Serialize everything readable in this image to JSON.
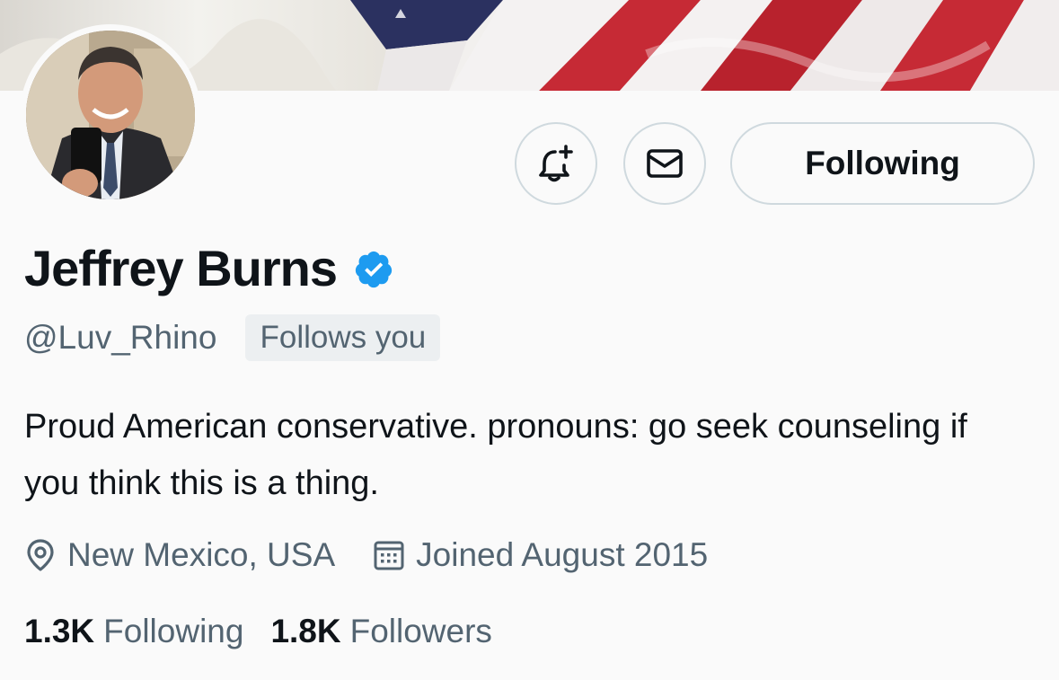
{
  "profile": {
    "display_name": "Jeffrey Burns",
    "handle": "@Luv_Rhino",
    "follows_you": "Follows you",
    "bio": "Proud American conservative. pronouns: go seek counseling if you think this is a thing.",
    "location": "New Mexico, USA",
    "joined": "Joined August 2015",
    "verified": true
  },
  "actions": {
    "follow_state_label": "Following"
  },
  "stats": {
    "following_count": "1.3K",
    "following_label": "Following",
    "followers_count": "1.8K",
    "followers_label": "Followers"
  },
  "icons": {
    "notify": "bell-plus-icon",
    "message": "envelope-icon",
    "verified": "verified-badge-icon",
    "location": "location-pin-icon",
    "calendar": "calendar-icon"
  },
  "colors": {
    "accent": "#1d9bf0",
    "text_primary": "#0f1419",
    "text_secondary": "#536471",
    "border": "#cfd9de",
    "banner_red": "#c62a35",
    "banner_navy": "#2b3160"
  }
}
